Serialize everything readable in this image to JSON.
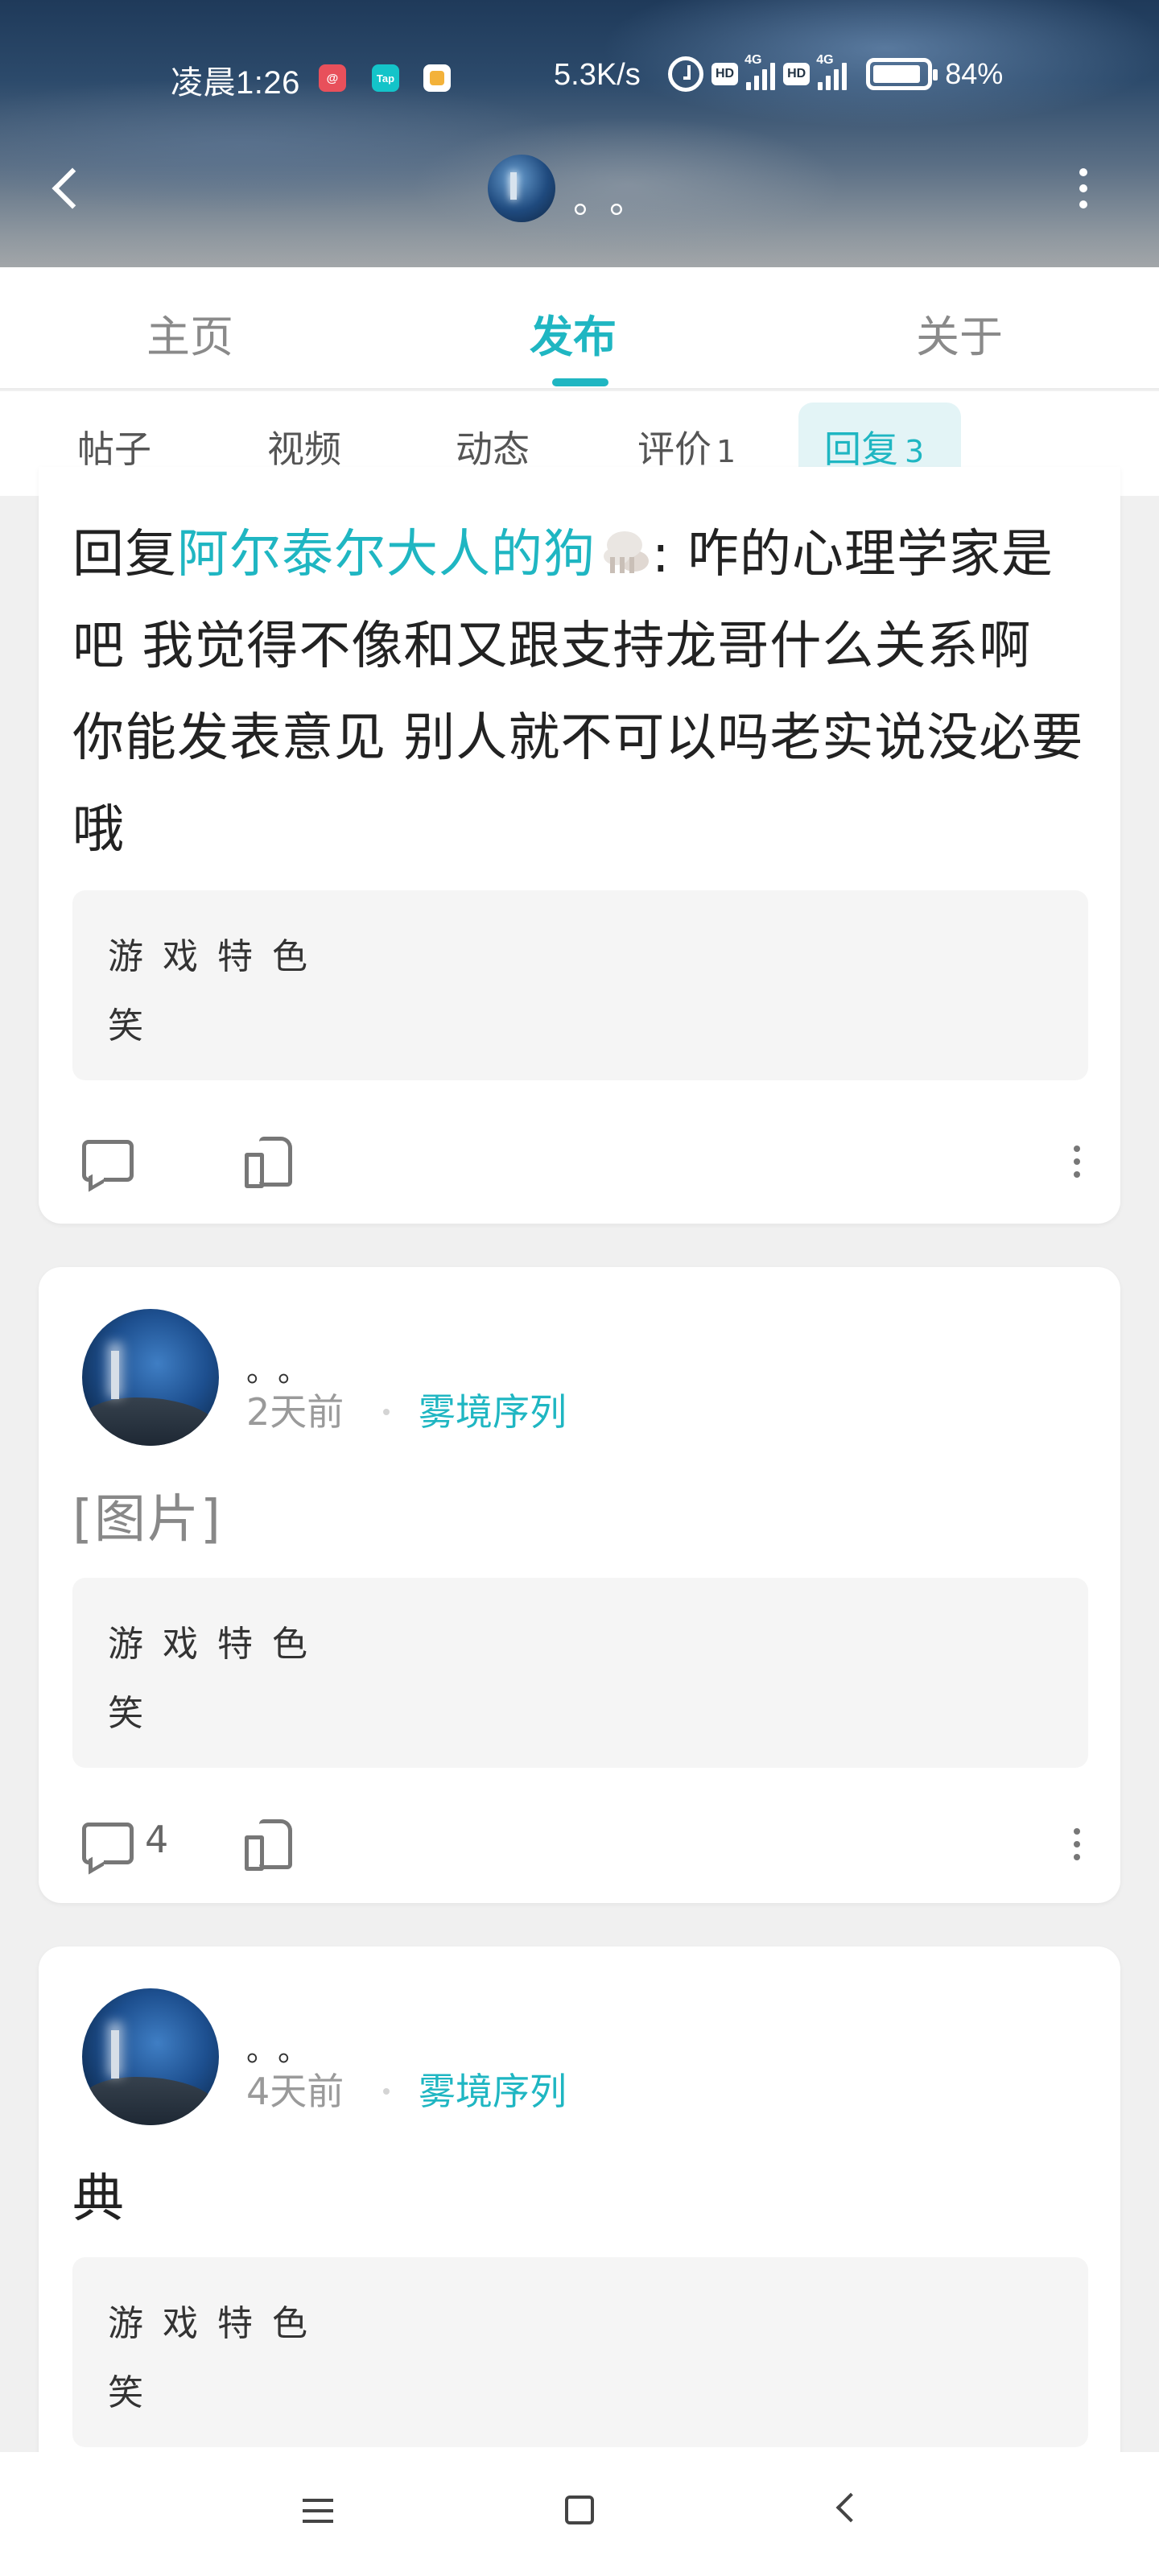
{
  "status_bar": {
    "time": "凌晨1:26",
    "speed": "5.3K/s",
    "hd": "HD",
    "network": "4G",
    "battery": "84%"
  },
  "header": {
    "username": "。。"
  },
  "main_tabs": [
    "主页",
    "发布",
    "关于"
  ],
  "sub_tabs": [
    {
      "label": "帖子"
    },
    {
      "label": "视频"
    },
    {
      "label": "动态"
    },
    {
      "label": "评价",
      "count": "1"
    },
    {
      "label": "回复",
      "count": "3"
    }
  ],
  "posts": [
    {
      "prefix": "回复",
      "mention": "阿尔泰尔大人的狗",
      "text": ": 咋的心理学家是吧 我觉得不像和又跟支持龙哥什么关系啊 你能发表意见 别人就不可以吗老实说没必要哦",
      "quote": {
        "title": "游戏特色",
        "sub": "笑"
      },
      "comments": ""
    },
    {
      "author": "。。",
      "time": "2天前",
      "game": "雾境序列",
      "body": "[图片]",
      "quote": {
        "title": "游戏特色",
        "sub": "笑"
      },
      "comments": "4"
    },
    {
      "author": "。。",
      "time": "4天前",
      "game": "雾境序列",
      "body": "典",
      "quote": {
        "title": "游戏特色",
        "sub": "笑"
      }
    }
  ],
  "colors": {
    "accent": "#1fb6c2",
    "active_tab_bg": "#e3f4f6",
    "background": "#f0f0f0"
  }
}
